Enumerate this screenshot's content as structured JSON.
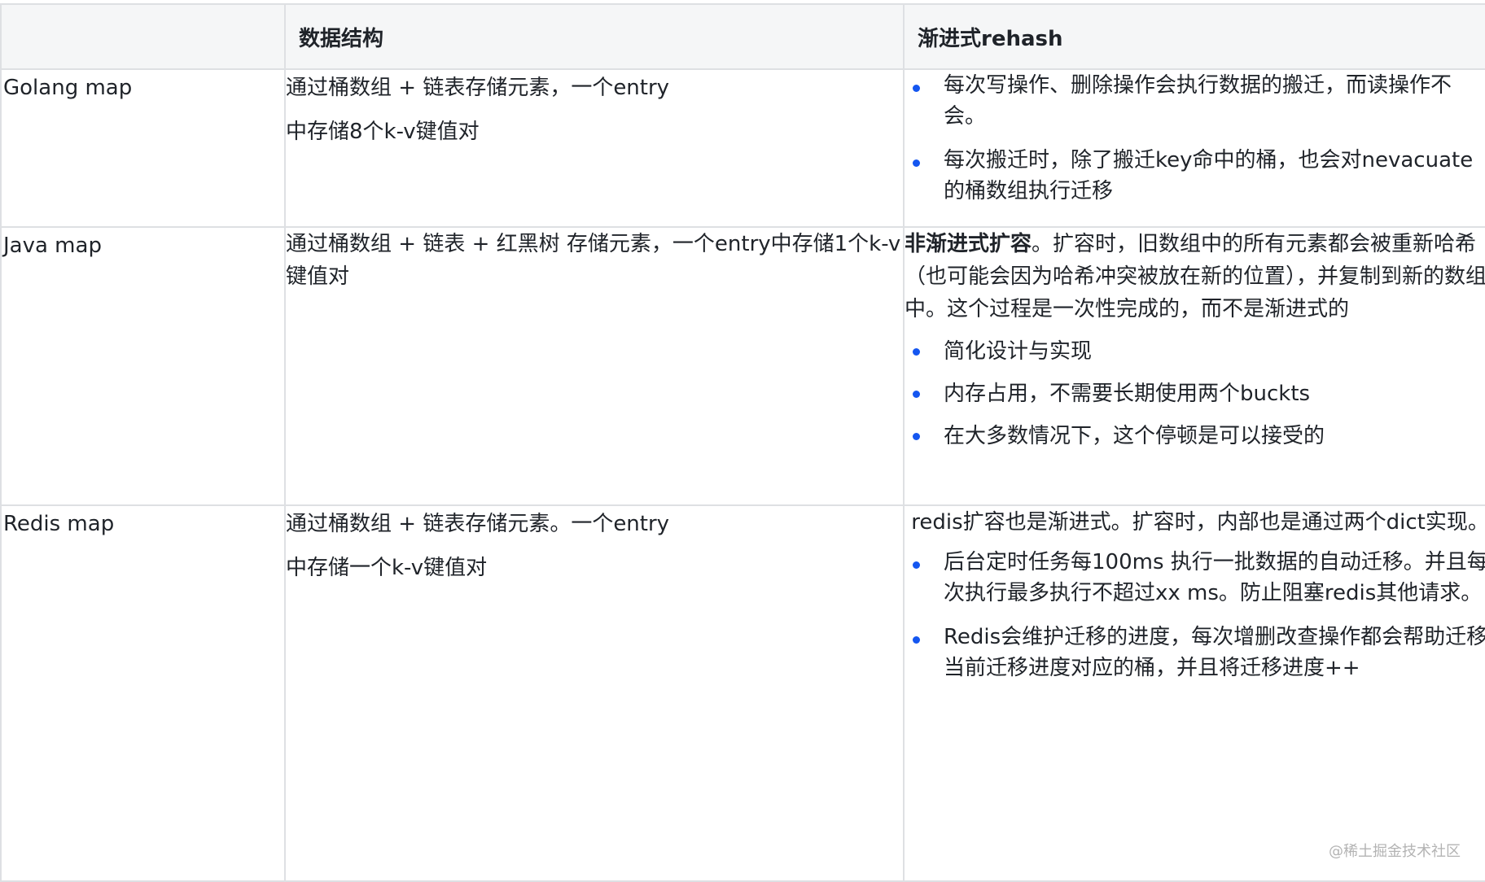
{
  "header": {
    "col1": "",
    "col2": "数据结构",
    "col3": "渐进式rehash"
  },
  "rows": [
    {
      "name": "Golang map",
      "structure": [
        "通过桶数组 + 链表存储元素，一个entry",
        "中存储8个k-v键值对"
      ],
      "rehash_intro_bold": "",
      "rehash_intro": "",
      "rehash_bullets": [
        "每次写操作、删除操作会执行数据的搬迁，而读操作不会。",
        "每次搬迁时，除了搬迁key命中的桶，也会对nevacuate的桶数组执行迁移"
      ]
    },
    {
      "name": "Java map",
      "structure": [
        "通过桶数组 + 链表 + 红黑树 存储元素，一个entry中存储1个k-v键值对"
      ],
      "rehash_intro_bold": "非渐进式扩容",
      "rehash_intro": "。扩容时，旧数组中的所有元素都会被重新哈希（也可能会因为哈希冲突被放在新的位置），并复制到新的数组中。这个过程是一次性完成的，而不是渐进式的",
      "rehash_bullets": [
        "简化设计与实现",
        "内存占用，不需要长期使用两个buckts",
        "在大多数情况下，这个停顿是可以接受的"
      ]
    },
    {
      "name": "Redis map",
      "structure": [
        "通过桶数组 + 链表存储元素。一个entry",
        "中存储一个k-v键值对"
      ],
      "rehash_intro_bold": "",
      "rehash_intro": " redis扩容也是渐进式。扩容时，内部也是通过两个dict实现。",
      "rehash_bullets": [
        "后台定时任务每100ms 执行一批数据的自动迁移。并且每次执行最多执行不超过xx ms。防止阻塞redis其他请求。",
        "Redis会维护迁移的进度，每次增删改查操作都会帮助迁移当前迁移进度对应的桶，并且将迁移进度++"
      ]
    }
  ],
  "watermark": "@稀土掘金技术社区",
  "colors": {
    "bullet": "#1456f0",
    "border": "#dee0e3",
    "header_bg": "#f5f6f7"
  }
}
